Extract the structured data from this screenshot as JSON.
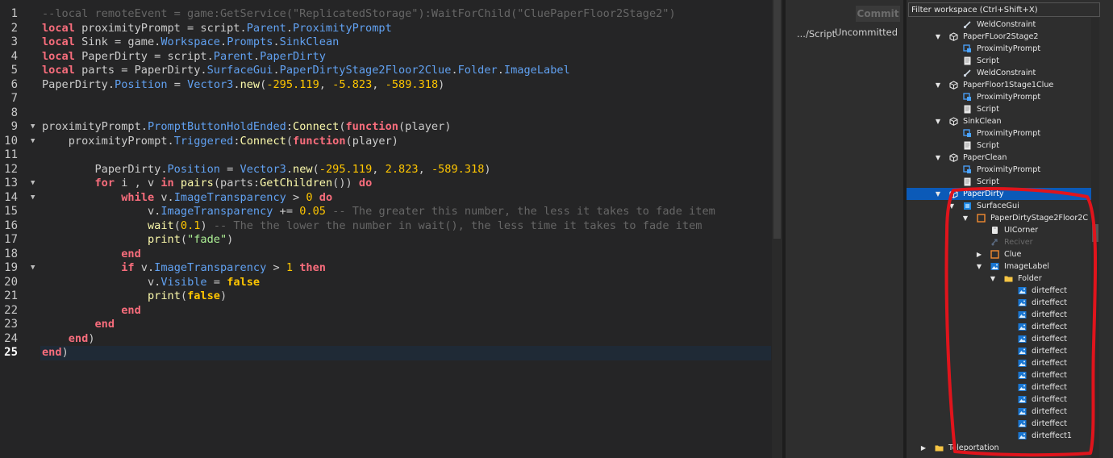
{
  "editor": {
    "current_line": 25,
    "lines": [
      [
        [
          "comment",
          "--local remoteEvent = game:GetService(\"ReplicatedStorage\"):WaitForChild(\"CluePaperFloor2Stage2\")"
        ]
      ],
      [
        [
          "kw",
          "local"
        ],
        [
          "id",
          " proximityPrompt = script."
        ],
        [
          "prop",
          "Parent"
        ],
        [
          "id",
          "."
        ],
        [
          "prop",
          "ProximityPrompt"
        ]
      ],
      [
        [
          "kw",
          "local"
        ],
        [
          "id",
          " Sink = game."
        ],
        [
          "prop",
          "Workspace"
        ],
        [
          "id",
          "."
        ],
        [
          "prop",
          "Prompts"
        ],
        [
          "id",
          "."
        ],
        [
          "prop",
          "SinkClean"
        ]
      ],
      [
        [
          "kw",
          "local"
        ],
        [
          "id",
          " PaperDirty = script."
        ],
        [
          "prop",
          "Parent"
        ],
        [
          "id",
          "."
        ],
        [
          "prop",
          "PaperDirty"
        ]
      ],
      [
        [
          "kw",
          "local"
        ],
        [
          "id",
          " parts = PaperDirty."
        ],
        [
          "prop",
          "SurfaceGui"
        ],
        [
          "id",
          "."
        ],
        [
          "prop",
          "PaperDirtyStage2Floor2Clue"
        ],
        [
          "id",
          "."
        ],
        [
          "prop",
          "Folder"
        ],
        [
          "id",
          "."
        ],
        [
          "prop",
          "ImageLabel"
        ]
      ],
      [
        [
          "id",
          "PaperDirty."
        ],
        [
          "prop",
          "Position"
        ],
        [
          "id",
          " = "
        ],
        [
          "prop",
          "Vector3"
        ],
        [
          "id",
          "."
        ],
        [
          "fn",
          "new"
        ],
        [
          "id",
          "("
        ],
        [
          "num",
          "-295.119"
        ],
        [
          "id",
          ", "
        ],
        [
          "num",
          "-5.823"
        ],
        [
          "id",
          ", "
        ],
        [
          "num",
          "-589.318"
        ],
        [
          "id",
          ")"
        ]
      ],
      [],
      [],
      [
        [
          "id",
          "proximityPrompt."
        ],
        [
          "prop",
          "PromptButtonHoldEnded"
        ],
        [
          "id",
          ":"
        ],
        [
          "fn",
          "Connect"
        ],
        [
          "id",
          "("
        ],
        [
          "kw",
          "function"
        ],
        [
          "id",
          "(player)"
        ]
      ],
      [
        [
          "id",
          "    proximityPrompt."
        ],
        [
          "prop",
          "Triggered"
        ],
        [
          "id",
          ":"
        ],
        [
          "fn",
          "Connect"
        ],
        [
          "id",
          "("
        ],
        [
          "kw",
          "function"
        ],
        [
          "id",
          "(player)"
        ]
      ],
      [],
      [
        [
          "id",
          "        PaperDirty."
        ],
        [
          "prop",
          "Position"
        ],
        [
          "id",
          " = "
        ],
        [
          "prop",
          "Vector3"
        ],
        [
          "id",
          "."
        ],
        [
          "fn",
          "new"
        ],
        [
          "id",
          "("
        ],
        [
          "num",
          "-295.119"
        ],
        [
          "id",
          ", "
        ],
        [
          "num",
          "2.823"
        ],
        [
          "id",
          ", "
        ],
        [
          "num",
          "-589.318"
        ],
        [
          "id",
          ")"
        ]
      ],
      [
        [
          "id",
          "        "
        ],
        [
          "kw",
          "for"
        ],
        [
          "id",
          " i , v "
        ],
        [
          "kw",
          "in"
        ],
        [
          "id",
          " "
        ],
        [
          "fn",
          "pairs"
        ],
        [
          "id",
          "(parts:"
        ],
        [
          "fn",
          "GetChildren"
        ],
        [
          "id",
          "()) "
        ],
        [
          "kw",
          "do"
        ]
      ],
      [
        [
          "id",
          "            "
        ],
        [
          "kw",
          "while"
        ],
        [
          "id",
          " v."
        ],
        [
          "prop",
          "ImageTransparency"
        ],
        [
          "id",
          " > "
        ],
        [
          "num",
          "0"
        ],
        [
          "id",
          " "
        ],
        [
          "kw",
          "do"
        ]
      ],
      [
        [
          "id",
          "                v."
        ],
        [
          "prop",
          "ImageTransparency"
        ],
        [
          "id",
          " += "
        ],
        [
          "num",
          "0.05"
        ],
        [
          "id",
          " "
        ],
        [
          "comment",
          "-- The greater this number, the less it takes to fade item"
        ]
      ],
      [
        [
          "id",
          "                "
        ],
        [
          "fn",
          "wait"
        ],
        [
          "id",
          "("
        ],
        [
          "num",
          "0.1"
        ],
        [
          "id",
          ") "
        ],
        [
          "comment",
          "-- The the lower the number in wait(), the less time it takes to fade item"
        ]
      ],
      [
        [
          "id",
          "                "
        ],
        [
          "fn",
          "print"
        ],
        [
          "id",
          "("
        ],
        [
          "str",
          "\"fade\""
        ],
        [
          "id",
          ")"
        ]
      ],
      [
        [
          "id",
          "            "
        ],
        [
          "kw",
          "end"
        ]
      ],
      [
        [
          "id",
          "            "
        ],
        [
          "kw",
          "if"
        ],
        [
          "id",
          " v."
        ],
        [
          "prop",
          "ImageTransparency"
        ],
        [
          "id",
          " > "
        ],
        [
          "num",
          "1"
        ],
        [
          "id",
          " "
        ],
        [
          "kw",
          "then"
        ]
      ],
      [
        [
          "id",
          "                v."
        ],
        [
          "prop",
          "Visible"
        ],
        [
          "id",
          " = "
        ],
        [
          "bool",
          "false"
        ]
      ],
      [
        [
          "id",
          "                "
        ],
        [
          "fn",
          "print"
        ],
        [
          "id",
          "("
        ],
        [
          "bool",
          "false"
        ],
        [
          "id",
          ")"
        ]
      ],
      [
        [
          "id",
          "            "
        ],
        [
          "kw",
          "end"
        ]
      ],
      [
        [
          "id",
          "        "
        ],
        [
          "kw",
          "end"
        ]
      ],
      [
        [
          "id",
          "    "
        ],
        [
          "kw",
          "end"
        ],
        [
          "id",
          ")"
        ]
      ],
      [
        [
          "kw",
          "end"
        ],
        [
          "id",
          ")"
        ]
      ]
    ],
    "fold_lines": [
      9,
      10,
      13,
      14,
      19
    ]
  },
  "commit_panel": {
    "commit_label": "Commit",
    "script_path": ".../Script",
    "status": "Uncommitted"
  },
  "explorer": {
    "filter_placeholder": "Filter workspace (Ctrl+Shift+X)",
    "items": [
      {
        "label": "WeldConstraint",
        "depth": 3,
        "icon": "weld-icon",
        "arrow": ""
      },
      {
        "label": "PaperFLoor2Stage2",
        "depth": 2,
        "icon": "model-icon",
        "arrow": "down"
      },
      {
        "label": "ProximityPrompt",
        "depth": 3,
        "icon": "prompt-icon",
        "arrow": ""
      },
      {
        "label": "Script",
        "depth": 3,
        "icon": "script-icon",
        "arrow": ""
      },
      {
        "label": "WeldConstraint",
        "depth": 3,
        "icon": "weld-icon",
        "arrow": ""
      },
      {
        "label": "PaperFloor1Stage1Clue",
        "depth": 2,
        "icon": "model-icon",
        "arrow": "down"
      },
      {
        "label": "ProximityPrompt",
        "depth": 3,
        "icon": "prompt-icon",
        "arrow": ""
      },
      {
        "label": "Script",
        "depth": 3,
        "icon": "script-icon",
        "arrow": ""
      },
      {
        "label": "SinkClean",
        "depth": 2,
        "icon": "model-icon",
        "arrow": "down"
      },
      {
        "label": "ProximityPrompt",
        "depth": 3,
        "icon": "prompt-icon",
        "arrow": ""
      },
      {
        "label": "Script",
        "depth": 3,
        "icon": "script-icon",
        "arrow": ""
      },
      {
        "label": "PaperClean",
        "depth": 2,
        "icon": "model-icon",
        "arrow": "down"
      },
      {
        "label": "ProximityPrompt",
        "depth": 3,
        "icon": "prompt-icon",
        "arrow": ""
      },
      {
        "label": "Script",
        "depth": 3,
        "icon": "script-icon",
        "arrow": ""
      },
      {
        "label": "PaperDirty",
        "depth": 2,
        "icon": "model-icon",
        "arrow": "down",
        "selected": true
      },
      {
        "label": "SurfaceGui",
        "depth": 3,
        "icon": "surfacegui-icon",
        "arrow": "down"
      },
      {
        "label": "PaperDirtyStage2Floor2C",
        "depth": 4,
        "icon": "frame-icon",
        "arrow": "down"
      },
      {
        "label": "UICorner",
        "depth": 5,
        "icon": "uicorner-icon",
        "arrow": ""
      },
      {
        "label": "Reciver",
        "depth": 5,
        "icon": "remote-icon",
        "arrow": "",
        "dim": true
      },
      {
        "label": "Clue",
        "depth": 5,
        "icon": "frame-icon",
        "arrow": "right"
      },
      {
        "label": "ImageLabel",
        "depth": 5,
        "icon": "imagelabel-icon",
        "arrow": "down"
      },
      {
        "label": "Folder",
        "depth": 6,
        "icon": "folder-icon",
        "arrow": "down"
      },
      {
        "label": "dirteffect",
        "depth": 7,
        "icon": "imagelabel-icon",
        "arrow": ""
      },
      {
        "label": "dirteffect",
        "depth": 7,
        "icon": "imagelabel-icon",
        "arrow": ""
      },
      {
        "label": "dirteffect",
        "depth": 7,
        "icon": "imagelabel-icon",
        "arrow": ""
      },
      {
        "label": "dirteffect",
        "depth": 7,
        "icon": "imagelabel-icon",
        "arrow": ""
      },
      {
        "label": "dirteffect",
        "depth": 7,
        "icon": "imagelabel-icon",
        "arrow": ""
      },
      {
        "label": "dirteffect",
        "depth": 7,
        "icon": "imagelabel-icon",
        "arrow": ""
      },
      {
        "label": "dirteffect",
        "depth": 7,
        "icon": "imagelabel-icon",
        "arrow": ""
      },
      {
        "label": "dirteffect",
        "depth": 7,
        "icon": "imagelabel-icon",
        "arrow": ""
      },
      {
        "label": "dirteffect",
        "depth": 7,
        "icon": "imagelabel-icon",
        "arrow": ""
      },
      {
        "label": "dirteffect",
        "depth": 7,
        "icon": "imagelabel-icon",
        "arrow": ""
      },
      {
        "label": "dirteffect",
        "depth": 7,
        "icon": "imagelabel-icon",
        "arrow": ""
      },
      {
        "label": "dirteffect",
        "depth": 7,
        "icon": "imagelabel-icon",
        "arrow": ""
      },
      {
        "label": "dirteffect1",
        "depth": 7,
        "icon": "imagelabel-icon",
        "arrow": ""
      },
      {
        "label": "Teleportation",
        "depth": 1,
        "icon": "folder-icon",
        "arrow": "right"
      }
    ]
  },
  "colors": {
    "keyword": "#f86d7c",
    "property": "#61a1f1",
    "function": "#fdfbac",
    "number": "#ffc600",
    "string": "#adf195",
    "comment": "#666666",
    "selection": "#0b5ab8",
    "annotation": "#e0141c"
  }
}
